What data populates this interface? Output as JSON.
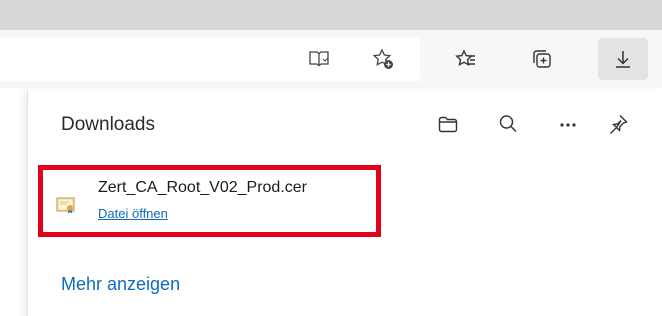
{
  "toolbar": {
    "buttons": [
      {
        "icon": "immersive-reader-icon"
      },
      {
        "icon": "add-favorite-icon"
      },
      {
        "icon": "favorites-icon"
      },
      {
        "icon": "collections-icon"
      },
      {
        "icon": "downloads-icon",
        "active": true
      }
    ]
  },
  "downloads_panel": {
    "title": "Downloads",
    "actions": [
      {
        "icon": "folder-icon"
      },
      {
        "icon": "search-icon"
      },
      {
        "icon": "more-icon"
      },
      {
        "icon": "pin-icon"
      }
    ],
    "items": [
      {
        "file_name": "Zert_CA_Root_V02_Prod.cer",
        "action_label": "Datei öffnen",
        "icon": "certificate-file-icon"
      }
    ],
    "show_more_label": "Mehr anzeigen"
  },
  "colors": {
    "accent": "#0f6cbd",
    "highlight_border": "#e2001a",
    "tabstrip": "#d7d7d7",
    "toolbar": "#f7f7f7"
  }
}
